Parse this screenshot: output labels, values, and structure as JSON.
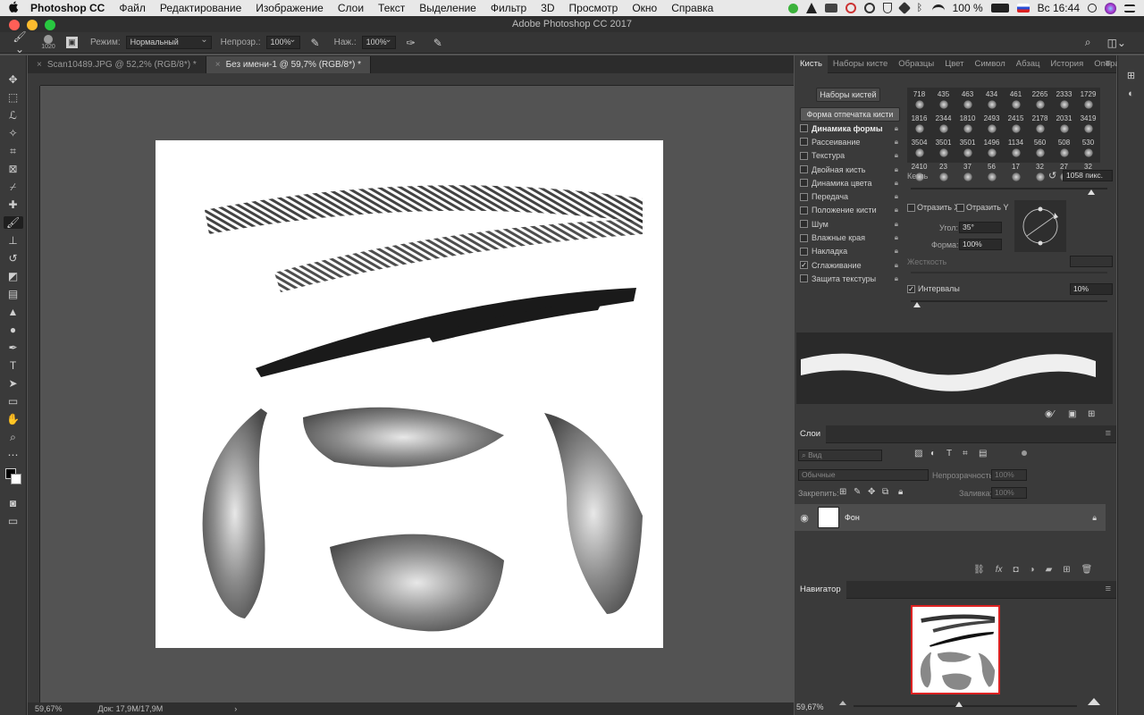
{
  "menubar": {
    "apple": "",
    "app_name": "Photoshop CC",
    "items": [
      "Файл",
      "Редактирование",
      "Изображение",
      "Слои",
      "Текст",
      "Выделение",
      "Фильтр",
      "3D",
      "Просмотр",
      "Окно",
      "Справка"
    ],
    "battery": "100 %",
    "clock": "Вс 16:44"
  },
  "window_title": "Adobe Photoshop CC 2017",
  "options": {
    "brush_size": "1020",
    "mode_label": "Режим:",
    "mode_value": "Нормальный",
    "opacity_label": "Непрозр.:",
    "opacity_value": "100%",
    "flow_label": "Наж.:",
    "flow_value": "100%"
  },
  "tabs": [
    {
      "label": "Scan10489.JPG @ 52,2% (RGB/8*) *"
    },
    {
      "label": "Без имени-1 @ 59,7% (RGB/8*) *"
    }
  ],
  "docstatus": {
    "zoom": "59,67%",
    "doc": "Док: 17,9M/17,9M",
    "arrow": "›"
  },
  "brush_panel": {
    "tabs": [
      "Кисть",
      "Наборы кисте",
      "Образцы",
      "Цвет",
      "Символ",
      "Абзац",
      "История",
      "Операции"
    ],
    "presets_button": "Наборы кистей",
    "tip_shape": "Форма отпечатка кисти",
    "options": [
      {
        "label": "Динамика формы",
        "checked": false
      },
      {
        "label": "Рассеивание",
        "checked": false
      },
      {
        "label": "Текстура",
        "checked": false
      },
      {
        "label": "Двойная кисть",
        "checked": false
      },
      {
        "label": "Динамика цвета",
        "checked": false
      },
      {
        "label": "Передача",
        "checked": false
      },
      {
        "label": "Положение кисти",
        "checked": false
      },
      {
        "label": "Шум",
        "checked": false
      },
      {
        "label": "Влажные края",
        "checked": false
      },
      {
        "label": "Накладка",
        "checked": false
      },
      {
        "label": "Сглаживание",
        "checked": true
      },
      {
        "label": "Защита текстуры",
        "checked": false
      }
    ],
    "tips": [
      "718",
      "435",
      "463",
      "434",
      "461",
      "2265",
      "2333",
      "1729",
      "1816",
      "2344",
      "1810",
      "2493",
      "2415",
      "2178",
      "2031",
      "3419",
      "3504",
      "3501",
      "3501",
      "1496",
      "1134",
      "560",
      "508",
      "530",
      "2410",
      "23",
      "37",
      "56",
      "17",
      "32",
      "27",
      "32"
    ],
    "size_label": "Кегль",
    "size_value": "1058 пикс.",
    "flip_x": "Отразить X",
    "flip_y": "Отразить Y",
    "angle_label": "Угол:",
    "angle_value": "35°",
    "roundness_label": "Форма:",
    "roundness_value": "100%",
    "hardness_label": "Жесткость",
    "spacing_label": "Интервалы",
    "spacing_value": "10%",
    "spacing_checked": true
  },
  "layers_panel": {
    "title": "Слои",
    "filter_label": "Вид",
    "blend": "Обычные",
    "opacity_label": "Непрозрачность:",
    "opacity_value": "100%",
    "lock_label": "Закрепить:",
    "fill_label": "Заливка:",
    "fill_value": "100%",
    "layer_name": "Фон"
  },
  "navigator": {
    "title": "Навигатор",
    "zoom": "59,67%"
  }
}
